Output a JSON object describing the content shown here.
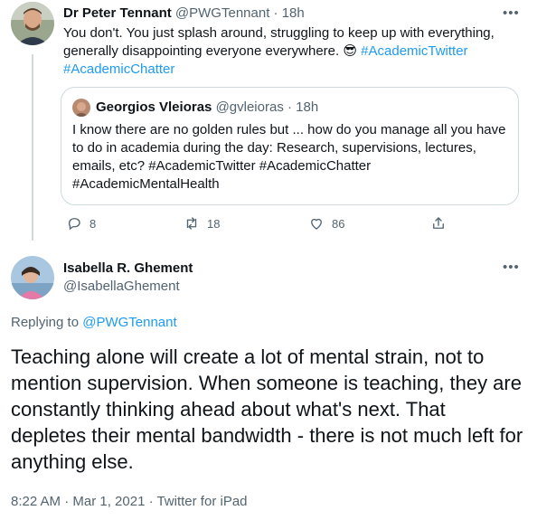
{
  "tweet": {
    "author_name": "Dr Peter Tennant",
    "author_handle": "@PWGTennant",
    "time": "· 18h",
    "text": "You don't. You just splash around, struggling to keep up with everything, generally disappointing everyone everywhere. 😎",
    "hashtag1": "#AcademicTwitter",
    "hashtag2": "#AcademicChatter",
    "replies": "8",
    "retweets": "18",
    "likes": "86"
  },
  "quoted": {
    "author_name": "Georgios Vleioras",
    "author_handle": "@gvleioras",
    "time": "· 18h",
    "text": "I know there are no golden rules but ... how do you manage all you have to do in academia during the day: Research, supervisions, lectures, emails, etc? #AcademicTwitter #AcademicChatter #AcademicMentalHealth"
  },
  "reply": {
    "author_name": "Isabella R. Ghement",
    "author_handle": "@IsabellaGhement",
    "replying_to_label": "Replying to",
    "replying_to_handle": "@PWGTennant",
    "text": "Teaching alone will create a lot of mental strain, not to mention supervision. When someone is teaching, they are constantly thinking ahead about what's next. That depletes their mental bandwidth - there is not much left  for anything else.",
    "meta": "8:22 AM · Mar 1, 2021 · Twitter for iPad"
  },
  "icons": {
    "more": "more-horizontal-icon",
    "reply": "reply-icon",
    "retweet": "retweet-icon",
    "like": "heart-icon",
    "share": "share-icon"
  },
  "colors": {
    "accent": "#1d9bf0",
    "muted": "#536471",
    "border": "#cfd9de"
  }
}
